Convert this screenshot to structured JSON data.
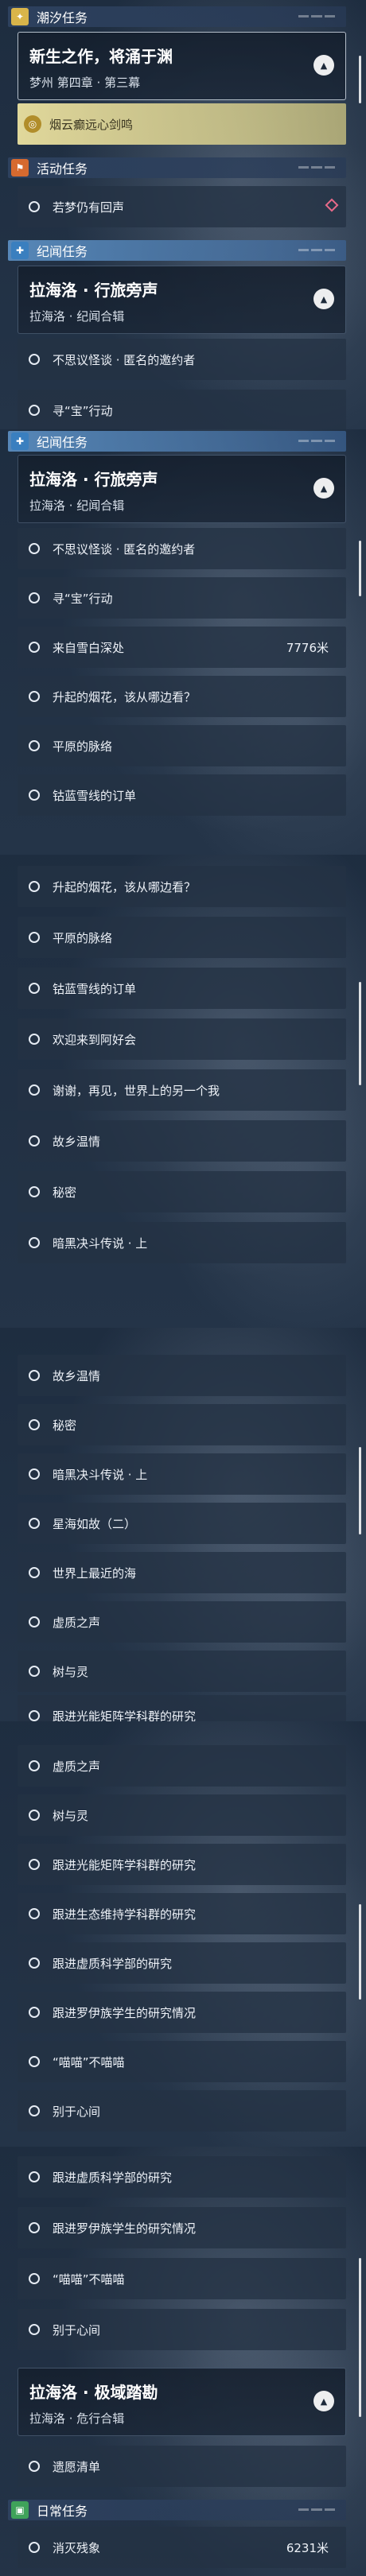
{
  "cat_chaoxi": {
    "title": "潮汐任务",
    "icon": "chaoxi-icon",
    "color": "#d9b54a"
  },
  "group_xinsheng": {
    "title": "新生之作，将涌于渊",
    "subtitle": "梦州 第四章 · 第三幕"
  },
  "highlight_quest": {
    "label": "烟云癫远心剑鸣"
  },
  "cat_huodong": {
    "title": "活动任务",
    "icon": "activity-icon",
    "color": "#d66a2f"
  },
  "quest_ruomeng": "若梦仍有回声",
  "cat_jiwen": {
    "title": "纪闻任务",
    "icon": "plus-icon",
    "color": "#3a7fbf"
  },
  "group_lxingluo": {
    "title": "拉海洛 · 行旅旁声",
    "subtitle": "拉海洛 · 纪闻合辑"
  },
  "quests": {
    "buke": "不思议怪谈 · 匿名的邀约者",
    "xunbao": "寻“宝”行动",
    "laizi": "来自雪白深处",
    "laizi_dist": "7776米",
    "shengqi": "升起的烟花，该从哪边看？",
    "pingyuan": "平原的脉络",
    "zuanlan": "钴蓝雪线的订单",
    "huanying": "欢迎来到阿好会",
    "xiexie": "谢谢，再见，世界上的另一个我",
    "guxiang": "故乡温情",
    "mimi": "秘密",
    "anhei": "暗黑决斗传说 · 上",
    "xinghai": "星海如故（二）",
    "shijie": "世界上最近的海",
    "xuzhi": "虚质之声",
    "shu": "树与灵",
    "genjin_guang": "跟进光能矩阵学科群的研究",
    "genjin_sheng": "跟进生态维持学科群的研究",
    "genjin_xuzhi": "跟进虚质科学部的研究",
    "genjin_luoyi": "跟进罗伊族学生的研究情况",
    "miaomiao": "“喵喵”不喵喵",
    "bieyu": "别于心间",
    "yiyuan": "遗愿清单",
    "xiaomie": "消灭残象",
    "xiaomie_dist": "6231米",
    "partial_xunbao": "寻“宝”行动"
  },
  "group_jiyu": {
    "title": "拉海洛 · 极域踏勘",
    "subtitle": "拉海洛 · 危行合辑"
  },
  "cat_richang": {
    "title": "日常任务",
    "icon": "daily-icon",
    "color": "#3fa25a"
  }
}
